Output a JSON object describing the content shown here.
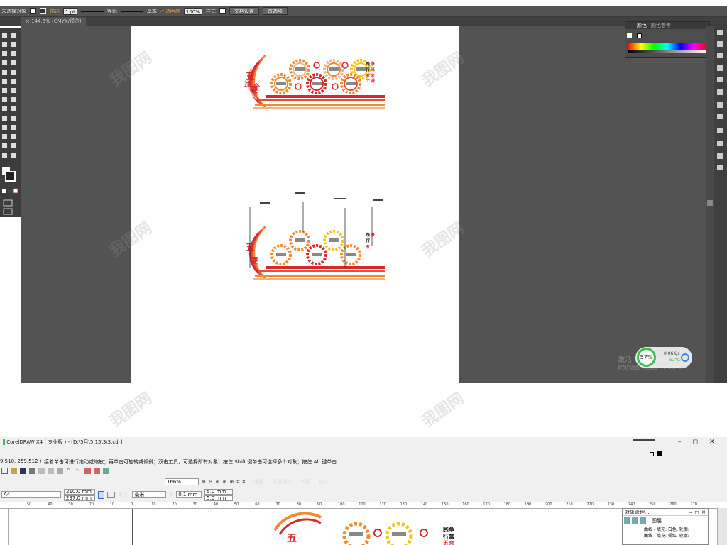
{
  "illustrator": {
    "control_bar": {
      "selection_label": "未选择对象",
      "stroke_label": "描边",
      "stroke_value": "1 pt",
      "profile1": "等比",
      "profile2": "基本",
      "opacity_label": "不透明度",
      "opacity_value": "100%",
      "style_label": "样式",
      "doc_setup": "文档设置",
      "preferences": "首选项"
    },
    "doc_tab": "144.6% (CMYK/预览)",
    "color_panel": {
      "tab1": "颜色",
      "tab2": "颜色参考"
    },
    "perf_widget": {
      "percent": "57%",
      "net": "0.06K/s",
      "cpu": "52°C"
    },
    "activate_windows": {
      "line1": "激活 Windows",
      "line2": "转到\"设置\"以激活 Windows。"
    }
  },
  "design": {
    "title_vertical": "五个过硬",
    "right_text_col1": "践行",
    "right_text_col2": "争当五个",
    "right_text_col3": "忠诚可靠"
  },
  "coreldraw": {
    "title": "CorelDRAW X4 ( 专业版 ) - [D:\\5月\\5.15\\3\\3.cdr]",
    "coords": "9.510, 259.512 )",
    "hint": "接着单击可进行拖动或缩放；再单击可旋转或倾斜；双击工具，可选择所有对象；按住 Shift 键单击可选择多个对象；按住 Alt 键单击...",
    "zoom": "166%",
    "toolbar_items": [
      "排版",
      "增强插件",
      "转换",
      "贴齐"
    ],
    "page_size": "A4",
    "width": "210.0 mm",
    "height": "297.0 mm",
    "unit_label": "单位:",
    "unit": "毫米",
    "nudge": "0.1 mm",
    "dup_x": "5.0 mm",
    "dup_y": "5.0 mm",
    "ruler_ticks": [
      "50",
      "40",
      "30",
      "20",
      "10",
      "0",
      "10",
      "20",
      "30",
      "40",
      "50",
      "60",
      "70",
      "80",
      "90",
      "100",
      "110",
      "120",
      "130",
      "140",
      "150",
      "160",
      "170",
      "180",
      "190",
      "200",
      "210",
      "220",
      "230",
      "240",
      "250",
      "260",
      "270"
    ],
    "object_manager": {
      "title": "对象管理...",
      "layer1": "图层 1",
      "row1": "曲线 - 填充: 白色, 轮廓: ",
      "row2": "曲线 - 填充: 橘红, 轮廓: "
    }
  }
}
